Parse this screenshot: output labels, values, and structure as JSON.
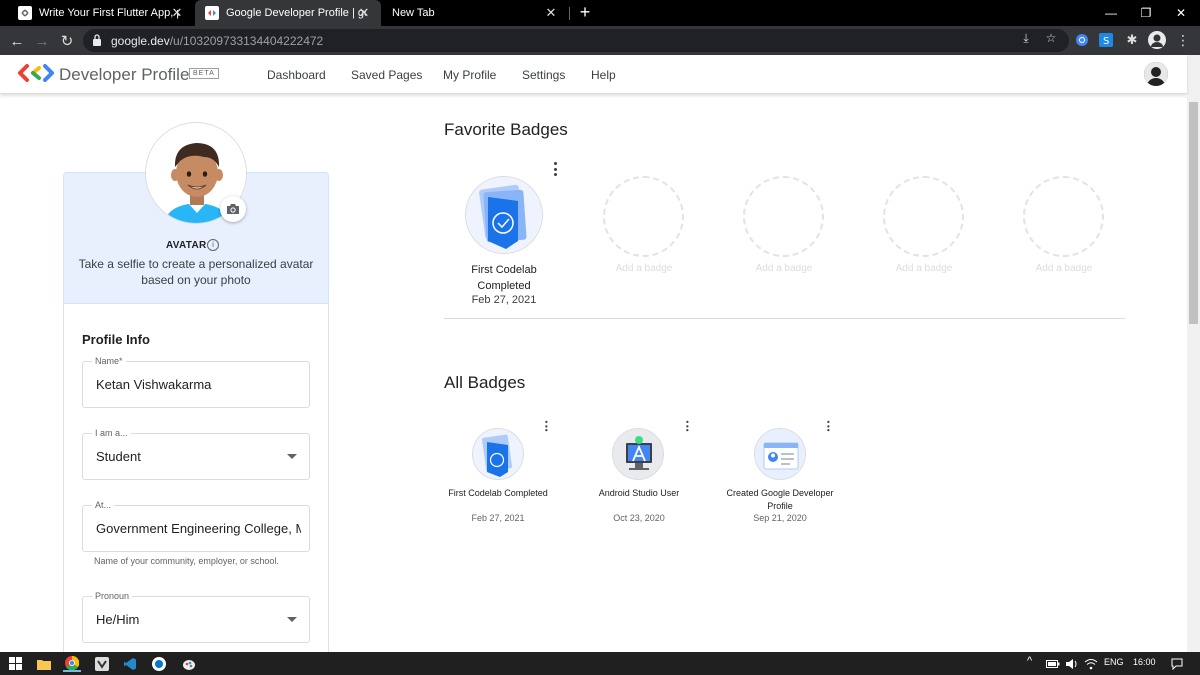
{
  "browser": {
    "tabs": [
      {
        "title": "Write Your First Flutter App, part"
      },
      {
        "title": "Google Developer Profile | goog"
      },
      {
        "title": "New Tab"
      }
    ],
    "url_host": "google.dev",
    "url_path": "/u/103209733134404222472"
  },
  "header": {
    "brand": "Developer Profile",
    "beta": "BETA",
    "nav": [
      "Dashboard",
      "Saved Pages",
      "My Profile",
      "Settings",
      "Help"
    ]
  },
  "profile": {
    "avatar_label": "AVATAR",
    "avatar_desc": "Take a selfie to create a personalized avatar based on your photo",
    "section_title": "Profile Info",
    "fields": [
      {
        "label": "Name*",
        "value": "Ketan Vishwakarma"
      },
      {
        "label": "I am a...",
        "value": "Student"
      },
      {
        "label": "At...",
        "value": "Government Engineering College, M"
      },
      {
        "label": "Pronoun",
        "value": "He/Him"
      }
    ],
    "helper": "Name of your community, employer, or school."
  },
  "favorite_badges": {
    "heading": "Favorite Badges",
    "badge": {
      "name": "First Codelab Completed",
      "date": "Feb 27, 2021"
    },
    "empty_label": "Add a badge"
  },
  "all_badges": {
    "heading": "All Badges",
    "items": [
      {
        "name": "First Codelab Completed",
        "date": "Feb 27, 2021"
      },
      {
        "name": "Android Studio User",
        "date": "Oct 23, 2020"
      },
      {
        "name": "Created Google Developer Profile",
        "date": "Sep 21, 2020"
      }
    ]
  },
  "taskbar": {
    "lang": "ENG",
    "time": "16:00"
  },
  "colors": {
    "accent_blue": "#1a73e8",
    "avatar_card_bg": "#e8f0fe",
    "chrome_dark": "#35363a"
  }
}
